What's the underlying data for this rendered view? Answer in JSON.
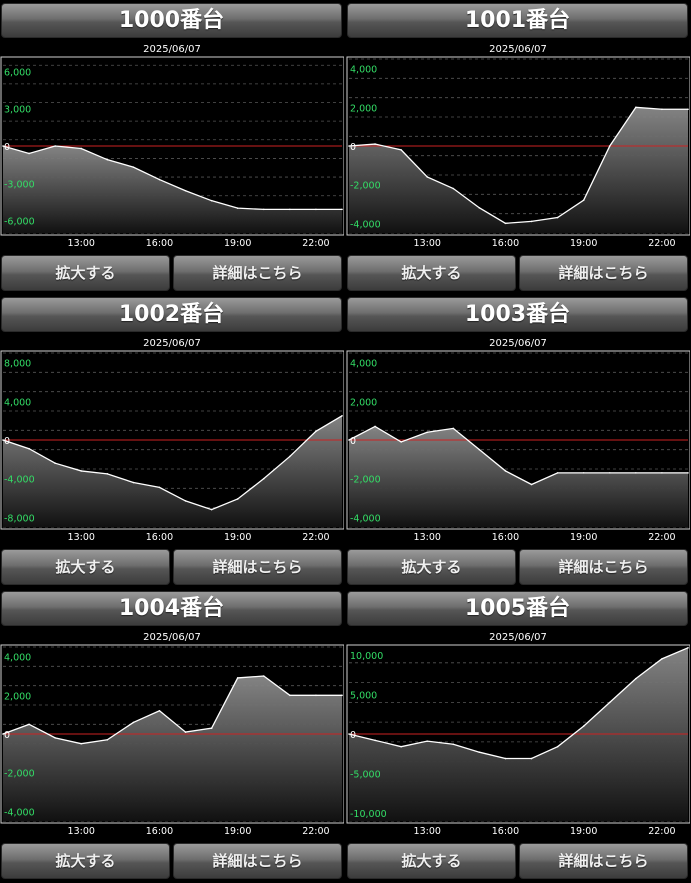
{
  "buttons": {
    "zoom_label": "拡大する",
    "detail_label": "詳細はこちら"
  },
  "colors": {
    "tick_y": "#33dd66",
    "tick_x": "#ffffff",
    "zero_line": "#cc2222",
    "series": "#ffffff"
  },
  "chart_data": [
    {
      "type": "area",
      "title": "1000番台",
      "date": "2025/06/07",
      "x": [
        "10:00",
        "11:00",
        "12:00",
        "13:00",
        "14:00",
        "15:00",
        "16:00",
        "17:00",
        "18:00",
        "19:00",
        "20:00",
        "21:00",
        "22:00",
        "23:00"
      ],
      "x_ticks": [
        "13:00",
        "16:00",
        "19:00",
        "22:00"
      ],
      "y_ticks": [
        6000,
        3000,
        0,
        -3000,
        -6000
      ],
      "y_tick_labels": [
        "6,000",
        "3,000",
        "0",
        "-3,000",
        "-6,000"
      ],
      "ylim": [
        -7000,
        7000
      ],
      "values": [
        0,
        -600,
        0,
        -200,
        -1100,
        -1700,
        -2700,
        -3600,
        -4400,
        -5000,
        -5100,
        -5100,
        -5100,
        -5100
      ]
    },
    {
      "type": "area",
      "title": "1001番台",
      "date": "2025/06/07",
      "x": [
        "10:00",
        "11:00",
        "12:00",
        "13:00",
        "14:00",
        "15:00",
        "16:00",
        "17:00",
        "18:00",
        "19:00",
        "20:00",
        "21:00",
        "22:00",
        "23:00"
      ],
      "x_ticks": [
        "13:00",
        "16:00",
        "19:00",
        "22:00"
      ],
      "y_ticks": [
        4000,
        2000,
        0,
        -2000,
        -4000
      ],
      "y_tick_labels": [
        "4,000",
        "2,000",
        "0",
        "-2,000",
        "-4,000"
      ],
      "ylim": [
        -4500,
        4500
      ],
      "values": [
        0,
        100,
        -200,
        -1600,
        -2200,
        -3200,
        -4000,
        -3900,
        -3700,
        -2800,
        0,
        2000,
        1900,
        1900
      ]
    },
    {
      "type": "area",
      "title": "1002番台",
      "date": "2025/06/07",
      "x": [
        "10:00",
        "11:00",
        "12:00",
        "13:00",
        "14:00",
        "15:00",
        "16:00",
        "17:00",
        "18:00",
        "19:00",
        "20:00",
        "21:00",
        "22:00",
        "23:00"
      ],
      "x_ticks": [
        "13:00",
        "16:00",
        "19:00",
        "22:00"
      ],
      "y_ticks": [
        8000,
        4000,
        0,
        -4000,
        -8000
      ],
      "y_tick_labels": [
        "8,000",
        "4,000",
        "0",
        "-4,000",
        "-8,000"
      ],
      "ylim": [
        -9000,
        9000
      ],
      "values": [
        0,
        -900,
        -2400,
        -3200,
        -3500,
        -4400,
        -4900,
        -6300,
        -7200,
        -6100,
        -4000,
        -1700,
        900,
        2500
      ]
    },
    {
      "type": "area",
      "title": "1003番台",
      "date": "2025/06/07",
      "x": [
        "10:00",
        "11:00",
        "12:00",
        "13:00",
        "14:00",
        "15:00",
        "16:00",
        "17:00",
        "18:00",
        "19:00",
        "20:00",
        "21:00",
        "22:00",
        "23:00"
      ],
      "x_ticks": [
        "13:00",
        "16:00",
        "19:00",
        "22:00"
      ],
      "y_ticks": [
        4000,
        2000,
        0,
        -2000,
        -4000
      ],
      "y_tick_labels": [
        "4,000",
        "2,000",
        "0",
        "-2,000",
        "-4,000"
      ],
      "ylim": [
        -4500,
        4500
      ],
      "values": [
        0,
        700,
        -100,
        400,
        600,
        -500,
        -1600,
        -2300,
        -1700,
        -1700,
        -1700,
        -1700,
        -1700,
        -1700
      ]
    },
    {
      "type": "area",
      "title": "1004番台",
      "date": "2025/06/07",
      "x": [
        "10:00",
        "11:00",
        "12:00",
        "13:00",
        "14:00",
        "15:00",
        "16:00",
        "17:00",
        "18:00",
        "19:00",
        "20:00",
        "21:00",
        "22:00",
        "23:00"
      ],
      "x_ticks": [
        "13:00",
        "16:00",
        "19:00",
        "22:00"
      ],
      "y_ticks": [
        4000,
        2000,
        0,
        -2000,
        -4000
      ],
      "y_tick_labels": [
        "4,000",
        "2,000",
        "0",
        "-2,000",
        "-4,000"
      ],
      "ylim": [
        -4500,
        4500
      ],
      "values": [
        0,
        500,
        -200,
        -500,
        -300,
        600,
        1200,
        100,
        300,
        2900,
        3000,
        2000,
        2000,
        2000
      ]
    },
    {
      "type": "area",
      "title": "1005番台",
      "date": "2025/06/07",
      "x": [
        "10:00",
        "11:00",
        "12:00",
        "13:00",
        "14:00",
        "15:00",
        "16:00",
        "17:00",
        "18:00",
        "19:00",
        "20:00",
        "21:00",
        "22:00",
        "23:00"
      ],
      "x_ticks": [
        "13:00",
        "16:00",
        "19:00",
        "22:00"
      ],
      "y_ticks": [
        10000,
        5000,
        0,
        -5000,
        -10000
      ],
      "y_tick_labels": [
        "10,000",
        "5,000",
        "0",
        "-5,000",
        "-10,000"
      ],
      "ylim": [
        -11000,
        11000
      ],
      "values": [
        0,
        -800,
        -1600,
        -900,
        -1300,
        -2300,
        -3100,
        -3100,
        -1600,
        1000,
        4000,
        7000,
        9500,
        10900
      ]
    }
  ]
}
